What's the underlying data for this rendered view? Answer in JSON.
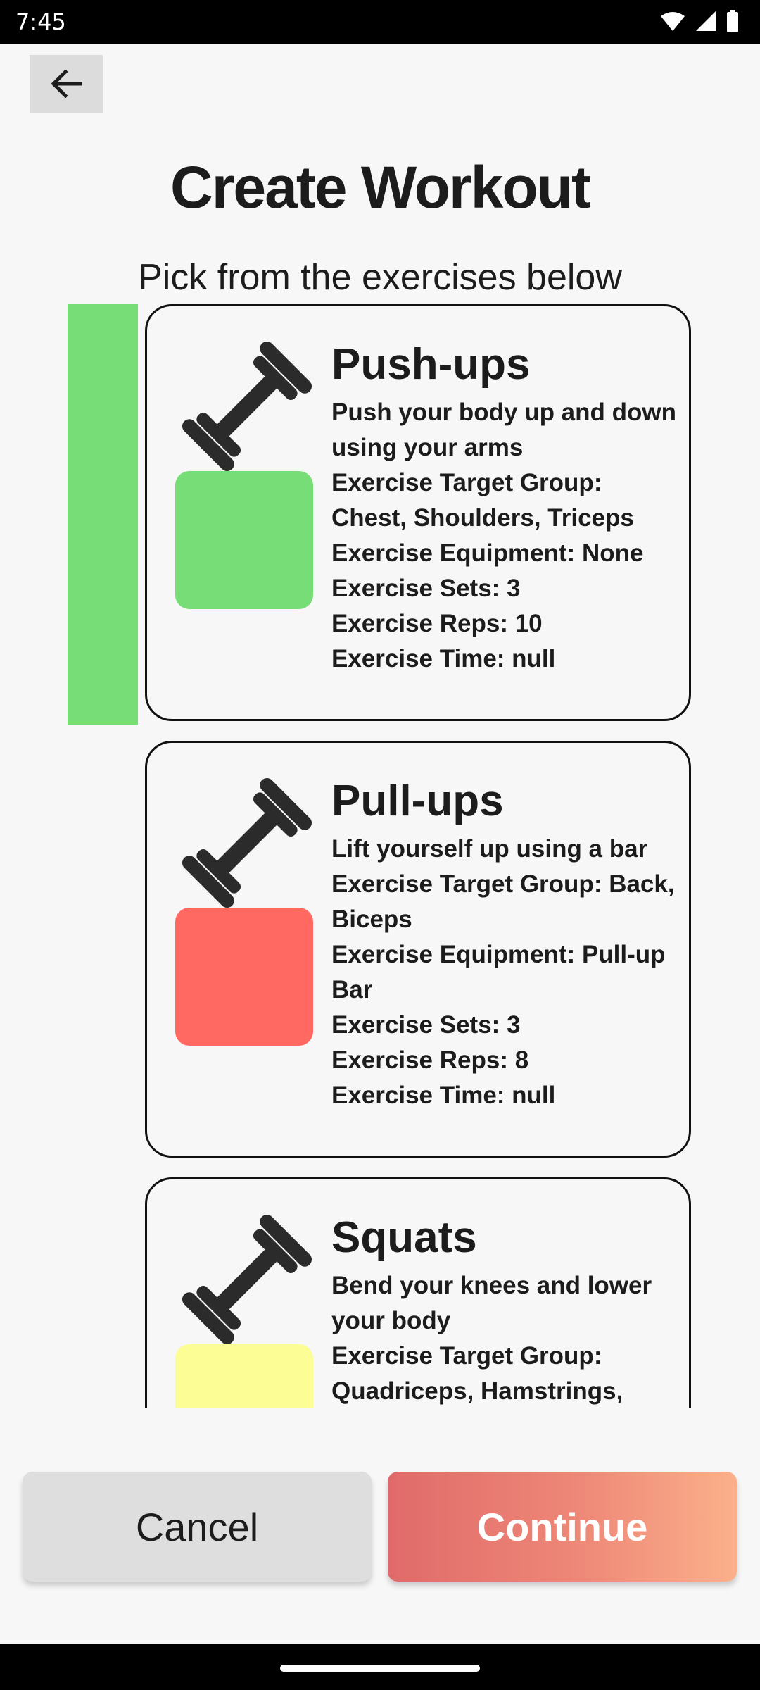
{
  "status": {
    "time": "7:45",
    "icons": [
      "wifi-icon",
      "signal-icon",
      "battery-icon"
    ]
  },
  "header": {
    "back_icon": "arrow-left-icon",
    "title": "Create Workout",
    "subtitle": "Pick from the exercises below"
  },
  "exercises": [
    {
      "name": "Push-ups",
      "description": "Push your body up and down using your arms",
      "target": "Exercise Target Group: Chest, Shoulders, Triceps",
      "equipment": "Exercise Equipment: None",
      "sets": "Exercise Sets: 3",
      "reps": "Exercise Reps: 10",
      "time": "Exercise Time: null",
      "color": "#77dd77",
      "selected": true,
      "icon": "dumbbell-icon"
    },
    {
      "name": "Pull-ups",
      "description": "Lift yourself up using a bar",
      "target": "Exercise Target Group: Back, Biceps",
      "equipment": "Exercise Equipment: Pull-up Bar",
      "sets": "Exercise Sets: 3",
      "reps": "Exercise Reps: 8",
      "time": "Exercise Time: null",
      "color": "#ff6961",
      "selected": false,
      "icon": "dumbbell-icon"
    },
    {
      "name": "Squats",
      "description": "Bend your knees and lower your body",
      "target": "Exercise Target Group: Quadriceps, Hamstrings,",
      "color": "#fdfd96",
      "selected": false,
      "icon": "dumbbell-icon"
    }
  ],
  "actions": {
    "cancel_label": "Cancel",
    "continue_label": "Continue"
  }
}
